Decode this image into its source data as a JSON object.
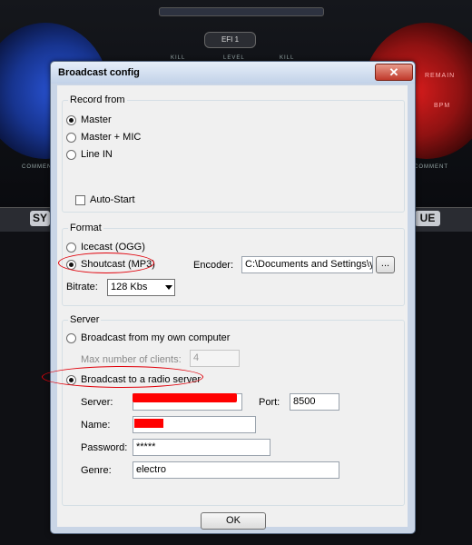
{
  "background": {
    "fx_label": "EFI 1",
    "knob_labels": [
      "KILL",
      "LEVEL",
      "KILL"
    ],
    "deck_right_texts": [
      "REMAIN",
      "BPM"
    ],
    "comment_labels": [
      "COMMENT",
      "COMMENT"
    ],
    "strip_buttons": [
      "SY",
      "UE"
    ]
  },
  "dialog": {
    "title": "Broadcast config",
    "close_glyph": "✕",
    "record_from": {
      "legend": "Record from",
      "options": [
        "Master",
        "Master + MIC",
        "Line IN"
      ],
      "selected": "Master",
      "auto_start": "Auto-Start"
    },
    "format": {
      "legend": "Format",
      "options": [
        "Icecast (OGG)",
        "Shoutcast (MP3)"
      ],
      "selected": "Shoutcast (MP3)",
      "encoder_label": "Encoder:",
      "encoder_value": "C:\\Documents and Settings\\yl",
      "browse_label": "...",
      "bitrate_label": "Bitrate:",
      "bitrate_value": "128 Kbs"
    },
    "server": {
      "legend": "Server",
      "own_computer": "Broadcast from my own computer",
      "max_clients_label": "Max number of clients:",
      "max_clients_value": "4",
      "radio_server": "Broadcast to a radio server",
      "selected": "Broadcast to a radio server",
      "server_label": "Server:",
      "port_label": "Port:",
      "port_value": "8500",
      "name_label": "Name:",
      "password_label": "Password:",
      "password_value": "*****",
      "genre_label": "Genre:",
      "genre_value": "electro"
    },
    "ok_label": "OK"
  },
  "colors": {
    "annotation_red": "#e0000a",
    "redaction_red": "#ff0000"
  }
}
